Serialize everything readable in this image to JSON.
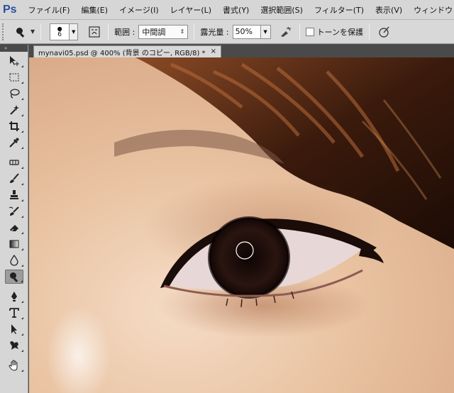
{
  "app": {
    "logo": "Ps"
  },
  "menu": [
    "ファイル(F)",
    "編集(E)",
    "イメージ(I)",
    "レイヤー(L)",
    "書式(Y)",
    "選択範囲(S)",
    "フィルター(T)",
    "表示(V)",
    "ウィンドウ"
  ],
  "options": {
    "brush_size": "6",
    "range_label": "範囲 :",
    "range_value": "中間調",
    "exposure_label": "露光量 :",
    "exposure_value": "50%",
    "protect_tones_label": "トーンを保護"
  },
  "document": {
    "tab_title": "mynavi05.psd @ 400% (背景 のコピー, RGB/8) *",
    "close_glyph": "×"
  },
  "toolbox": {
    "collapse_glyph": "»",
    "active_tool": "burn-tool"
  }
}
